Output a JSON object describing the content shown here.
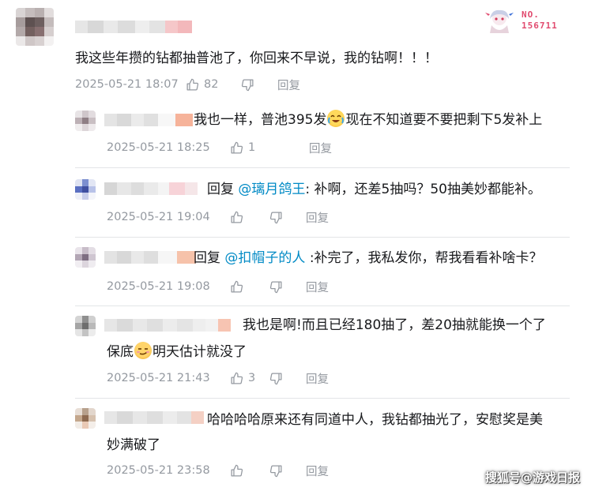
{
  "badge": {
    "line1": "NO.",
    "line2": "156711"
  },
  "main_comment": {
    "text": "我这些年攒的钻都抽普池了，你回来不早说，我的钻啊！！！",
    "time": "2025-05-21 18:07",
    "likes": "82",
    "reply_label": "回复"
  },
  "replies": [
    {
      "text_before": "我也一样，普池395发",
      "emoji": "laugh-cry-emoji",
      "text_after": "现在不知道要不要把剩下5发补上",
      "time": "2025-05-21 18:25",
      "likes": "1",
      "reply_label": "回复"
    },
    {
      "reply_word": "回复",
      "mention": "@璃月鸽王",
      "text": ": 补啊，还差5抽吗？50抽美妙都能补。",
      "time": "2025-05-21 19:04",
      "likes": "",
      "reply_label": "回复"
    },
    {
      "reply_word": "回复",
      "mention": "@扣帽子的人",
      "text": ":补完了，我私发你，帮我看看补啥卡？",
      "time": "2025-05-21 19:08",
      "likes": "",
      "reply_label": "回复"
    },
    {
      "line1": "我也是啊!而且已经180抽了，差20抽就能换一个了",
      "line2_before": "保底",
      "emoji": "smug-emoji",
      "line2_after": "明天估计就没了",
      "time": "2025-05-21 21:43",
      "likes": "3",
      "reply_label": "回复"
    },
    {
      "line1": "哈哈哈哈原来还有同道中人，我钻都抽光了，安慰奖是美",
      "line2": "妙满破了",
      "time": "2025-05-21 23:58",
      "likes": "",
      "reply_label": "回复"
    }
  ],
  "watermark": "搜狐号@游戏日报",
  "colors": {
    "mention": "#008ac5",
    "meta": "#9499a0",
    "text": "#18191c",
    "badge_red": "#e14b6f"
  }
}
